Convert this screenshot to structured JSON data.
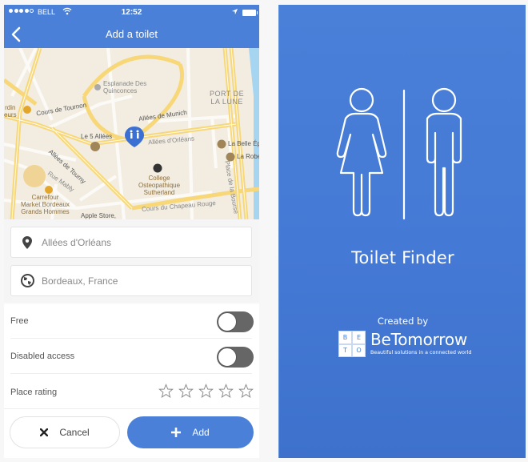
{
  "status_bar": {
    "signal_bars": 4,
    "signal_total": 5,
    "carrier": "BELL",
    "time": "12:52",
    "wifi_icon": "wifi-icon",
    "location_icon": "location-arrow-icon",
    "battery_icon": "battery-full-icon"
  },
  "nav_bar": {
    "back_icon": "chevron-left-icon",
    "title": "Add a toilet"
  },
  "map": {
    "marker_icon": "toilet-pin-icon",
    "labels": {
      "cours_de_tournon": "Cours de Tournon",
      "esplanade": "Esplanade Des\nQuinconces",
      "port_de_la_lune": "PORT DE\nLA LUNE",
      "allees_de_munich": "Allées de Munich",
      "le_5_allees": "Le 5 Allées",
      "allees_dorleans": "Allées d'Orléans",
      "la_belle_epoque": "La Belle Épo",
      "la_robe": "La Robe",
      "allees_de_tourny": "Allées de Tourny",
      "rue_mably": "Rue Mably",
      "college": "College\nOsteopathique\nSutherland",
      "carrefour": "Carrefour\nMarket Bordeaux\nGrands Hommes",
      "place_de_la_bourse": "Place de la Bourse",
      "cours_du_chapeau_rouge": "Cours du Chapeau Rouge",
      "apple_store": "Apple Store,",
      "jardin": "rdin\neurs",
      "cours_partial": "Cou"
    }
  },
  "address": {
    "street": {
      "icon": "map-pin-icon",
      "value": "",
      "placeholder": "Allées d'Orléans"
    },
    "city": {
      "icon": "globe-icon",
      "value": "",
      "placeholder": "Bordeaux, France"
    }
  },
  "options": {
    "free": {
      "label": "Free",
      "on": false
    },
    "disabled_access": {
      "label": "Disabled access",
      "on": false
    },
    "rating": {
      "label": "Place rating",
      "value": 0,
      "max": 5
    }
  },
  "actions": {
    "cancel": {
      "label": "Cancel",
      "icon": "close-x-icon"
    },
    "add": {
      "label": "Add",
      "icon": "plus-icon"
    }
  },
  "splash": {
    "icon": "restroom-man-woman-icon",
    "app_name": "Toilet Finder",
    "created_by": "Created by",
    "company_logo_letters": [
      "B",
      "E",
      "T",
      "O"
    ],
    "company_name": "BeTomorrow",
    "company_tagline": "Beautiful  solutions in a connected world"
  },
  "colors": {
    "primary": "#4a80d8",
    "toggle_track": "#666666",
    "text_gray": "#555555"
  }
}
